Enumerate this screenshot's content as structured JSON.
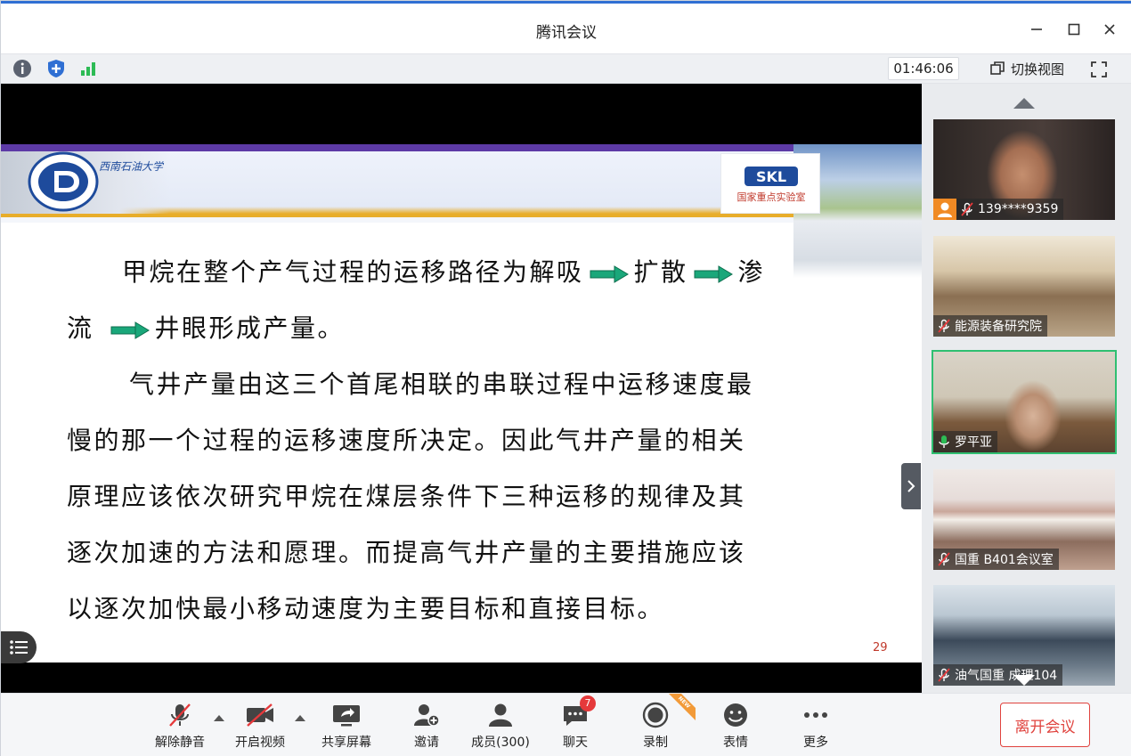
{
  "window": {
    "title": "腾讯会议"
  },
  "toolbar": {
    "timer": "01:46:06",
    "switch_view_label": "切换视图"
  },
  "slide": {
    "university_name": "西南石油大学",
    "lab_logo_text": "SKL",
    "lab_name": "国家重点实验室",
    "lines": [
      "甲烷在整个产气过程的运移路径为解吸",
      "扩散",
      "渗",
      "流",
      "井眼形成产量。",
      "气井产量由这三个首尾相联的串联过程中运移速度最",
      "慢的那一个过程的运移速度所决定。因此气井产量的相关",
      "原理应该依次研究甲烷在煤层条件下三种运移的规律及其",
      "逐次加速的方法和愿理。而提高气井产量的主要措施应该",
      "以逐次加快最小移动速度为主要目标和直接目标。"
    ],
    "page_number": "29"
  },
  "participants": [
    {
      "name": "139****9359",
      "muted": true
    },
    {
      "name": "能源装备研究院",
      "muted": true
    },
    {
      "name": "罗平亚",
      "muted": false
    },
    {
      "name": "国重 B401会议室",
      "muted": true
    },
    {
      "name": "油气国重 成理104",
      "muted": true
    }
  ],
  "controls": {
    "unmute": "解除静音",
    "start_video": "开启视频",
    "share_screen": "共享屏幕",
    "invite": "邀请",
    "members": "成员(300)",
    "chat": "聊天",
    "chat_badge": "7",
    "record": "录制",
    "new_badge": "NEW",
    "reactions": "表情",
    "more": "更多",
    "leave": "离开会议"
  },
  "colors": {
    "accent": "#2f6fd3",
    "leave": "#e0433e",
    "active_speaker": "#2fbf71",
    "arrow": "#1aa77a"
  }
}
